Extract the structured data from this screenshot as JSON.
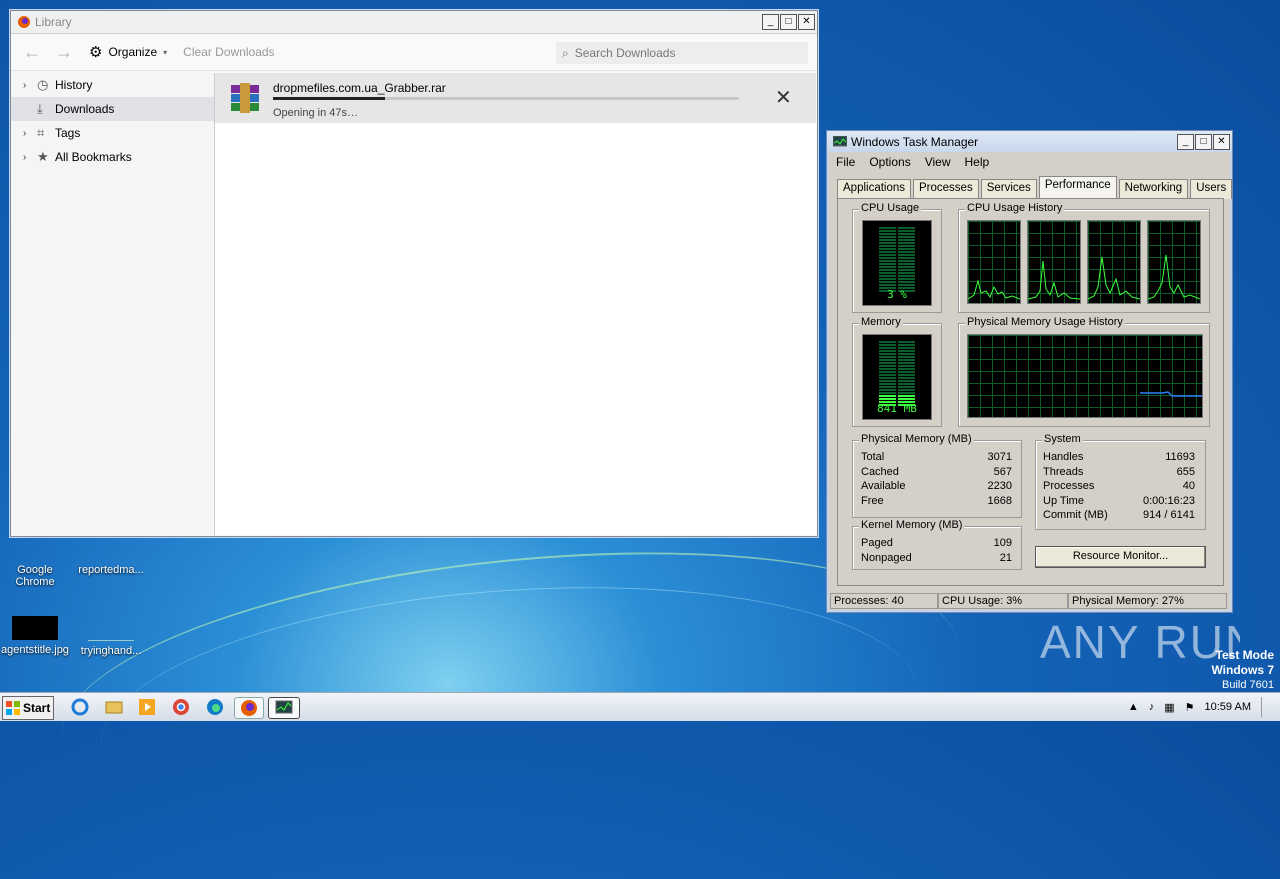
{
  "desktop": {
    "icons": [
      {
        "label_line1": "Google",
        "label_line2": "Chrome"
      },
      {
        "label_line1": "reportedma...",
        "label_line2": ""
      },
      {
        "label_line1": "agentstitle.jpg",
        "label_line2": ""
      },
      {
        "label_line1": "tryinghand...",
        "label_line2": ""
      }
    ],
    "watermark": "ANY RUN",
    "testmode": {
      "line1": "Test Mode",
      "line2": "Windows 7",
      "line3": "Build 7601"
    }
  },
  "library": {
    "title": "Library",
    "organize_label": "Organize",
    "clear_label": "Clear Downloads",
    "search_placeholder": "Search Downloads",
    "sidebar": [
      {
        "label": "History"
      },
      {
        "label": "Downloads"
      },
      {
        "label": "Tags"
      },
      {
        "label": "All Bookmarks"
      }
    ],
    "download": {
      "filename": "dropmefiles.com.ua_Grabber.rar",
      "status": "Opening in 47s…",
      "progress": 0.24
    }
  },
  "taskmgr": {
    "title": "Windows Task Manager",
    "menu": [
      "File",
      "Options",
      "View",
      "Help"
    ],
    "tabs": [
      "Applications",
      "Processes",
      "Services",
      "Performance",
      "Networking",
      "Users"
    ],
    "active_tab": "Performance",
    "cpu_usage_label": "CPU Usage",
    "cpu_usage_value": "3 %",
    "cpu_history_label": "CPU Usage History",
    "memory_label": "Memory",
    "memory_value": "841 MB",
    "mem_history_label": "Physical Memory Usage History",
    "physical": {
      "title": "Physical Memory (MB)",
      "rows": [
        {
          "k": "Total",
          "v": "3071"
        },
        {
          "k": "Cached",
          "v": "567"
        },
        {
          "k": "Available",
          "v": "2230"
        },
        {
          "k": "Free",
          "v": "1668"
        }
      ]
    },
    "kernel": {
      "title": "Kernel Memory (MB)",
      "rows": [
        {
          "k": "Paged",
          "v": "109"
        },
        {
          "k": "Nonpaged",
          "v": "21"
        }
      ]
    },
    "system": {
      "title": "System",
      "rows": [
        {
          "k": "Handles",
          "v": "11693"
        },
        {
          "k": "Threads",
          "v": "655"
        },
        {
          "k": "Processes",
          "v": "40"
        },
        {
          "k": "Up Time",
          "v": "0:00:16:23"
        },
        {
          "k": "Commit (MB)",
          "v": "914 / 6141"
        }
      ]
    },
    "resource_monitor": "Resource Monitor...",
    "status": {
      "processes": "Processes: 40",
      "cpu": "CPU Usage: 3%",
      "memory": "Physical Memory: 27%"
    }
  },
  "taskbar": {
    "start": "Start",
    "clock": "10:59 AM"
  },
  "colors": {
    "graph_green": "#3dff3d",
    "grid": "#0b5d2a",
    "memline": "#2a7fff"
  }
}
